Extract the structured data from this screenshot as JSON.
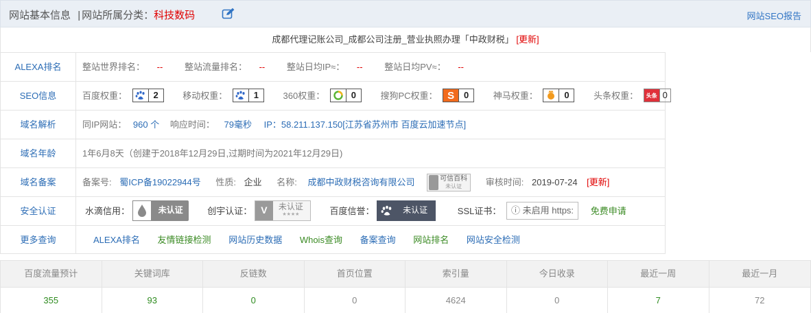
{
  "header": {
    "basic_info": "网站基本信息",
    "separator": "|",
    "category_label": "网站所属分类：",
    "category_value": "科技数码",
    "seo_report": "网站SEO报告"
  },
  "site_title": "成都代理记账公司_成都公司注册_营业执照办理「中政财税」",
  "update_label": "[更新]",
  "rows": {
    "alexa": {
      "label": "ALEXA排名",
      "items": [
        {
          "name": "整站世界排名：",
          "value": "--"
        },
        {
          "name": "整站流量排名：",
          "value": "--"
        },
        {
          "name": "整站日均IP≈：",
          "value": "--"
        },
        {
          "name": "整站日均PV≈：",
          "value": "--"
        }
      ]
    },
    "seo": {
      "label": "SEO信息",
      "items": [
        {
          "name": "百度权重：",
          "value": "2",
          "icon": "baidu-paw-icon",
          "color": "#3068c8"
        },
        {
          "name": "移动权重：",
          "value": "1",
          "icon": "baidu-paw-icon",
          "color": "#3068c8"
        },
        {
          "name": "360权重：",
          "value": "0",
          "icon": "360-ring-icon",
          "color": "#59b434"
        },
        {
          "name": "搜狗PC权重：",
          "value": "0",
          "icon": "sogou-s-icon",
          "color": "#f26b1d"
        },
        {
          "name": "神马权重：",
          "value": "0",
          "icon": "shenma-icon",
          "color": "#f29a1d"
        },
        {
          "name": "头条权重：",
          "value": "0",
          "icon": "toutiao-icon",
          "color": "#e0303a"
        }
      ]
    },
    "dns": {
      "label": "域名解析",
      "same_ip_label": "同IP网站：",
      "same_ip_value": "960 个",
      "response_label": "响应时间：",
      "response_value": "79毫秒",
      "ip_text": "IP：58.211.137.150[江苏省苏州市 百度云加速节点]"
    },
    "age": {
      "label": "域名年龄",
      "text": "1年6月8天（创建于2018年12月29日,过期时间为2021年12月29日)"
    },
    "record": {
      "label": "域名备案",
      "no_label": "备案号:",
      "no_value": "蜀ICP备19022944号",
      "nature_label": "性质:",
      "nature_value": "企业",
      "name_label": "名称:",
      "name_value": "成都中政财税咨询有限公司",
      "baike_line1": "可信百科",
      "baike_line2": "未认证",
      "audit_label": "审核时间:",
      "audit_value": "2019-07-24",
      "update_label": "[更新]"
    },
    "security": {
      "label": "安全认证",
      "shuidi_label": "水滴信用：",
      "shuidi_badge": "未认证",
      "chuangyu_label": "创宇认证：",
      "chuangyu_badge": "未认证",
      "chuangyu_stars": "★★★★",
      "baidu_label": "百度信誉：",
      "baidu_badge": "未认证",
      "ssl_label": "SSL证书：",
      "ssl_box_info": "ⓘ",
      "ssl_box": "未启用 https:",
      "ssl_apply": "免费申请"
    },
    "more": {
      "label": "更多查询",
      "links": [
        {
          "text": "ALEXA排名",
          "color": "#2b6cb5"
        },
        {
          "text": "友情链接检测",
          "color": "#3a8a23"
        },
        {
          "text": "网站历史数据",
          "color": "#2b6cb5"
        },
        {
          "text": "Whois查询",
          "color": "#3a8a23"
        },
        {
          "text": "备案查询",
          "color": "#2b6cb5"
        },
        {
          "text": "网站排名",
          "color": "#3a8a23"
        },
        {
          "text": "网站安全检测",
          "color": "#2b6cb5"
        }
      ]
    }
  },
  "stats": {
    "headers": [
      "百度流量预计",
      "关键词库",
      "反链数",
      "首页位置",
      "索引量",
      "今日收录",
      "最近一周",
      "最近一月"
    ],
    "values": [
      "355",
      "93",
      "0",
      "0",
      "4624",
      "0",
      "7",
      "72"
    ]
  }
}
